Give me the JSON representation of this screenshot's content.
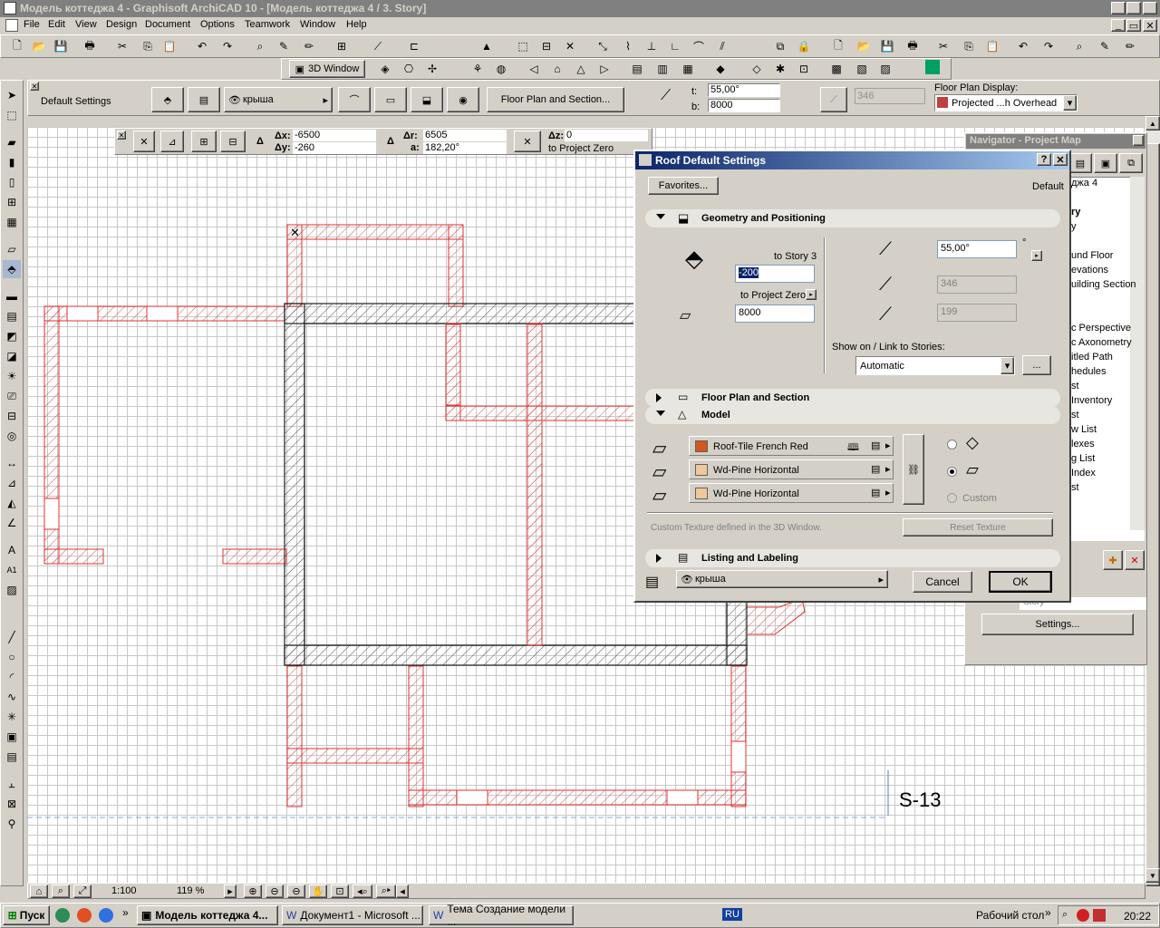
{
  "app": {
    "title": "Модель коттеджа 4 - Graphisoft ArchiCAD 10 - [Модель коттеджа 4 / 3. Story]"
  },
  "menu": [
    "File",
    "Edit",
    "View",
    "Design",
    "Document",
    "Options",
    "Teamwork",
    "Window",
    "Help"
  ],
  "toolbar2": {
    "window_3d": "3D Window"
  },
  "infobox": {
    "default_settings": "Default Settings",
    "layer": "крыша",
    "floor_plan_section": "Floor Plan and Section...",
    "t_label": "t:",
    "t_value": "55,00°",
    "b_label": "b:",
    "b_value": "8000",
    "disabled_value": "346",
    "fp_display_label": "Floor Plan Display:",
    "fp_display_value": "Projected ...h Overhead"
  },
  "coords": {
    "dx_label": "Δx:",
    "dx_value": "-6500",
    "dy_label": "Δy:",
    "dy_value": "-260",
    "dr_label": "Δr:",
    "dr_value": "6505",
    "a_label": "a:",
    "a_value": "182,20°",
    "dz_label": "Δz:",
    "dz_value": "0",
    "project_zero": "to Project Zero"
  },
  "canvas": {
    "marker": "S-13"
  },
  "navigator": {
    "title": "Navigator - Project Map",
    "items": [
      "джа 4",
      "ry",
      "y",
      "und Floor",
      "evations",
      "uilding Section",
      "c Perspective",
      "c Axonometry",
      "itled Path",
      "hedules",
      "st",
      "Inventory",
      "st",
      "w List",
      "lexes",
      "g List",
      "Index",
      "st"
    ],
    "story_field": "Story",
    "settings_button": "Settings..."
  },
  "dialog": {
    "title": "Roof Default Settings",
    "favorites": "Favorites...",
    "default_label": "Default",
    "sections": {
      "geometry": "Geometry and Positioning",
      "floor_plan": "Floor Plan and Section",
      "model": "Model",
      "listing": "Listing and Labeling"
    },
    "geometry": {
      "to_story": "to Story 3",
      "story_offset": "-200",
      "to_project_zero": "to Project Zero",
      "thickness": "8000",
      "pitch": "55,00°",
      "pitch_unit": "°",
      "value2": "346",
      "value3": "199",
      "show_on_label": "Show on / Link to Stories:",
      "show_on_value": "Automatic",
      "more": "..."
    },
    "model": {
      "materials": [
        {
          "name": "Roof-Tile French Red",
          "color": "#d2571e"
        },
        {
          "name": "Wd-Pine Horizontal",
          "color": "#f0c89a"
        },
        {
          "name": "Wd-Pine Horizontal",
          "color": "#f0c89a"
        }
      ],
      "custom": "Custom",
      "custom_texture_note": "Custom Texture defined in the 3D Window.",
      "reset_texture": "Reset Texture"
    },
    "layer": "крыша",
    "cancel": "Cancel",
    "ok": "OK"
  },
  "statusbar": {
    "scale": "1:100",
    "zoom": "119 %"
  },
  "taskbar": {
    "start": "Пуск",
    "tasks": [
      "Модель коттеджа 4...",
      "Документ1 - Microsoft ...",
      "Тема Создание модели ..."
    ],
    "lang": "RU",
    "desktop": "Рабочий стол",
    "time": "20:22"
  }
}
